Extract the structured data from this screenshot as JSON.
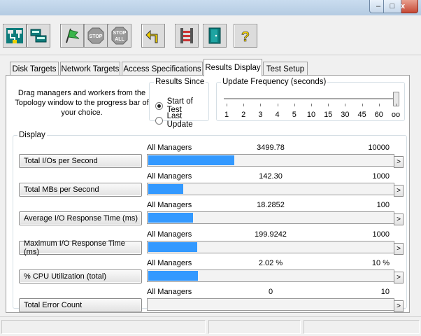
{
  "window": {
    "minimize_glyph": "–",
    "maximize_glyph": "□",
    "close_glyph": "x"
  },
  "toolbar": {
    "buttons": [
      {
        "name": "topology-icon"
      },
      {
        "name": "network-icon"
      },
      {
        "name": "start-flag-icon"
      },
      {
        "name": "stop-icon",
        "label": "STOP"
      },
      {
        "name": "stop-all-icon",
        "label": "STOP ALL"
      },
      {
        "name": "reset-arrow-icon"
      },
      {
        "name": "workers-icon"
      },
      {
        "name": "exit-door-icon"
      },
      {
        "name": "help-icon",
        "label": "?"
      }
    ]
  },
  "tabs": [
    {
      "label": "Disk Targets",
      "active": false
    },
    {
      "label": "Network Targets",
      "active": false
    },
    {
      "label": "Access Specifications",
      "active": false
    },
    {
      "label": "Results Display",
      "active": true
    },
    {
      "label": "Test Setup",
      "active": false
    }
  ],
  "instructions": "Drag managers and workers from the Topology window to the progress bar of your choice.",
  "results_since": {
    "legend": "Results Since",
    "options": [
      {
        "label": "Start of Test",
        "selected": true
      },
      {
        "label": "Last Update",
        "selected": false
      }
    ]
  },
  "update_frequency": {
    "legend": "Update Frequency (seconds)",
    "ticks": [
      "1",
      "2",
      "3",
      "4",
      "5",
      "10",
      "15",
      "30",
      "45",
      "60",
      "oo"
    ],
    "selected": "oo"
  },
  "display": {
    "legend": "Display",
    "rows": [
      {
        "label": "Total I/Os per Second",
        "manager": "All Managers",
        "value": "3499.78",
        "max": "10000",
        "fraction": 0.35
      },
      {
        "label": "Total MBs per Second",
        "manager": "All Managers",
        "value": "142.30",
        "max": "1000",
        "fraction": 0.142
      },
      {
        "label": "Average I/O Response Time (ms)",
        "manager": "All Managers",
        "value": "18.2852",
        "max": "100",
        "fraction": 0.183
      },
      {
        "label": "Maximum I/O Response Time (ms)",
        "manager": "All Managers",
        "value": "199.9242",
        "max": "1000",
        "fraction": 0.2
      },
      {
        "label": "% CPU Utilization (total)",
        "manager": "All Managers",
        "value": "2.02 %",
        "max": "10 %",
        "fraction": 0.202
      },
      {
        "label": "Total Error Count",
        "manager": "All Managers",
        "value": "0",
        "max": "10",
        "fraction": 0
      }
    ],
    "more_glyph": ">"
  },
  "colors": {
    "bar_fill": "#3399ff",
    "panel_bg": "#ffffff",
    "window_bg": "#f0f0f0"
  }
}
